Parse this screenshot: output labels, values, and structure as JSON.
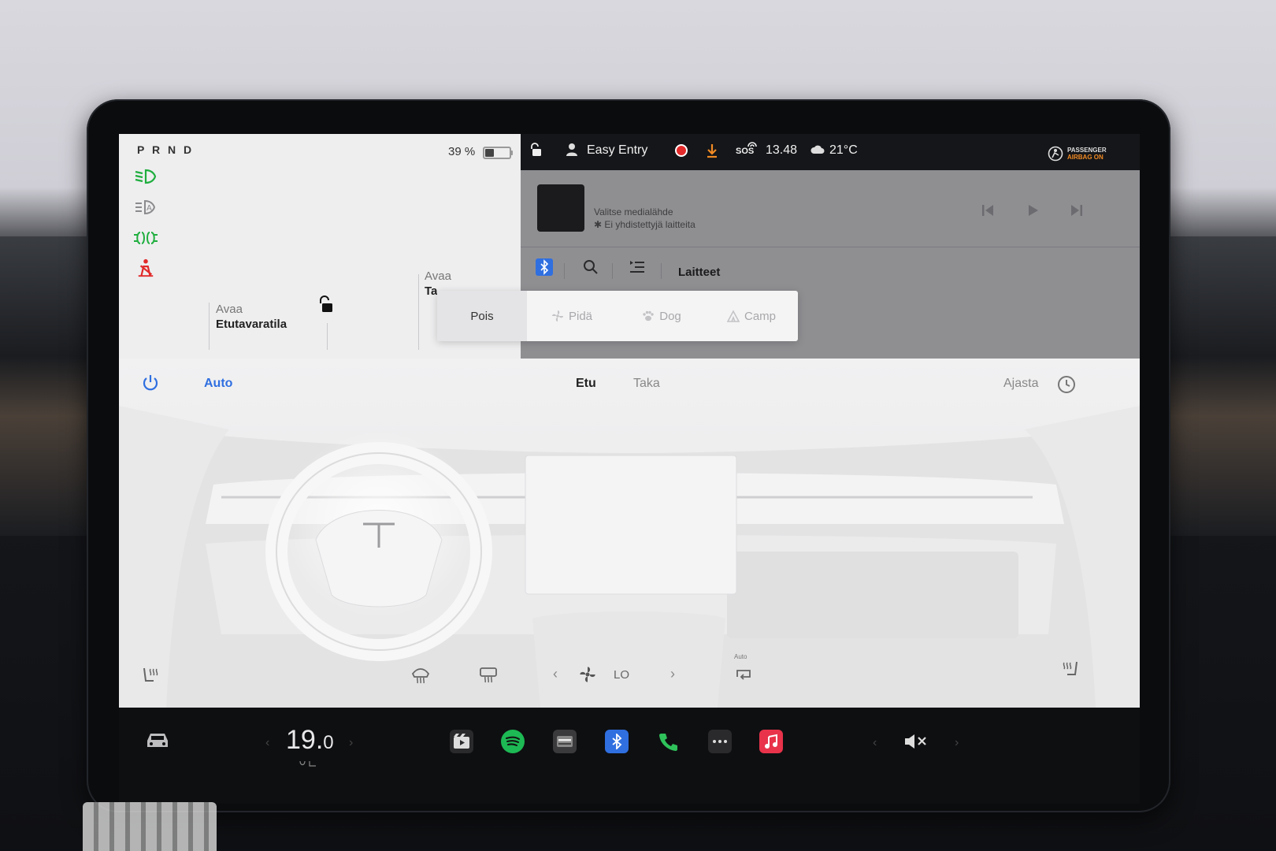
{
  "car": {
    "gear": "P R N D",
    "battery_percent_label": "39 %",
    "battery_level": 0.39,
    "frunk_action": "Avaa",
    "frunk_label": "Etutavaratila",
    "trunk_action": "Avaa",
    "trunk_label_partial": "Ta"
  },
  "status_bar": {
    "profile": "Easy Entry",
    "sos": "SOS",
    "time": "13.48",
    "temperature": "21°C",
    "airbag_line1": "PASSENGER",
    "airbag_line2": "AIRBAG ON"
  },
  "media": {
    "source_prompt": "Valitse medialähde",
    "device_status": "Ei yhdistettyjä laitteita",
    "tab_label": "Laitteet"
  },
  "climate_keeper": {
    "options": [
      {
        "label": "Pois",
        "icon": "none",
        "selected": true
      },
      {
        "label": "Pidä",
        "icon": "fan-icon",
        "selected": false
      },
      {
        "label": "Dog",
        "icon": "paw-icon",
        "selected": false
      },
      {
        "label": "Camp",
        "icon": "tent-icon",
        "selected": false
      }
    ]
  },
  "climate": {
    "auto_label": "Auto",
    "front_tab": "Etu",
    "rear_tab": "Taka",
    "schedule_label": "Ajasta",
    "fan_speed": "LO",
    "recirc_label": "Auto"
  },
  "dock": {
    "cabin_temp_main": "19.",
    "cabin_temp_decimal": "0",
    "apps": [
      "theater-icon",
      "spotify-icon",
      "toybox-icon",
      "bluetooth-icon",
      "phone-icon",
      "more-icon",
      "music-icon"
    ]
  },
  "colors": {
    "accent_blue": "#2f6fe0",
    "indicator_green": "#1fae3e",
    "alert_red": "#e12a2a",
    "spotify_green": "#1db954",
    "music_red": "#e8334a",
    "download_orange": "#f08a24"
  }
}
